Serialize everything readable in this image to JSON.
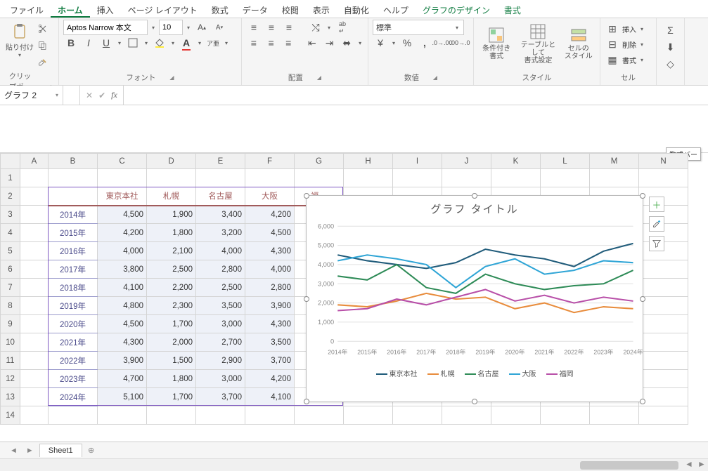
{
  "tabs": {
    "file": "ファイル",
    "home": "ホーム",
    "insert": "挿入",
    "pagelayout": "ページ レイアウト",
    "formulas": "数式",
    "data": "データ",
    "review": "校閲",
    "view": "表示",
    "automate": "自動化",
    "help": "ヘルプ",
    "chartdesign": "グラフのデザイン",
    "format": "書式"
  },
  "ribbon": {
    "clipboard": "クリップボード",
    "font": "フォント",
    "alignment": "配置",
    "number": "数値",
    "styles": "スタイル",
    "cells": "セル",
    "paste": "貼り付け",
    "font_name": "Aptos Narrow 本文",
    "font_size": "10",
    "number_format": "標準",
    "condfmt": "条件付き\n書式",
    "tablefmt": "テーブルとして\n書式設定",
    "cellstyles": "セルの\nスタイル",
    "insert_btn": "挿入",
    "delete_btn": "削除",
    "format_btn": "書式"
  },
  "namebox": "グラフ 2",
  "fx_tooltip": "数式バー",
  "cols": [
    "A",
    "B",
    "C",
    "D",
    "E",
    "F",
    "G",
    "H",
    "I",
    "J",
    "K",
    "L",
    "M",
    "N"
  ],
  "rows": [
    "1",
    "2",
    "3",
    "4",
    "5",
    "6",
    "7",
    "8",
    "9",
    "10",
    "11",
    "12",
    "13",
    "14"
  ],
  "table": {
    "loc_headers": [
      "",
      "東京本社",
      "札幌",
      "名古屋",
      "大阪",
      "福岡"
    ],
    "years": [
      "2014年",
      "2015年",
      "2016年",
      "2017年",
      "2018年",
      "2019年",
      "2020年",
      "2021年",
      "2022年",
      "2023年",
      "2024年"
    ],
    "data": [
      [
        "4,500",
        "1,900",
        "3,400",
        "4,200"
      ],
      [
        "4,200",
        "1,800",
        "3,200",
        "4,500"
      ],
      [
        "4,000",
        "2,100",
        "4,000",
        "4,300"
      ],
      [
        "3,800",
        "2,500",
        "2,800",
        "4,000"
      ],
      [
        "4,100",
        "2,200",
        "2,500",
        "2,800"
      ],
      [
        "4,800",
        "2,300",
        "3,500",
        "3,900"
      ],
      [
        "4,500",
        "1,700",
        "3,000",
        "4,300"
      ],
      [
        "4,300",
        "2,000",
        "2,700",
        "3,500"
      ],
      [
        "3,900",
        "1,500",
        "2,900",
        "3,700"
      ],
      [
        "4,700",
        "1,800",
        "3,000",
        "4,200"
      ],
      [
        "5,100",
        "1,700",
        "3,700",
        "4,100"
      ]
    ],
    "cut_value": "2,100"
  },
  "chart_data": {
    "type": "line",
    "title": "グラフ タイトル",
    "categories": [
      "2014年",
      "2015年",
      "2016年",
      "2017年",
      "2018年",
      "2019年",
      "2020年",
      "2021年",
      "2022年",
      "2023年",
      "2024年"
    ],
    "series": [
      {
        "name": "東京本社",
        "color": "#1f5b7a",
        "values": [
          4500,
          4200,
          4000,
          3800,
          4100,
          4800,
          4500,
          4300,
          3900,
          4700,
          5100
        ]
      },
      {
        "name": "札幌",
        "color": "#e88c3c",
        "values": [
          1900,
          1800,
          2100,
          2500,
          2200,
          2300,
          1700,
          2000,
          1500,
          1800,
          1700
        ]
      },
      {
        "name": "名古屋",
        "color": "#2e8b57",
        "values": [
          3400,
          3200,
          4000,
          2800,
          2500,
          3500,
          3000,
          2700,
          2900,
          3000,
          3700
        ]
      },
      {
        "name": "大阪",
        "color": "#2fa5d6",
        "values": [
          4200,
          4500,
          4300,
          4000,
          2800,
          3900,
          4300,
          3500,
          3700,
          4200,
          4100
        ]
      },
      {
        "name": "福岡",
        "color": "#b84fa8",
        "values": [
          1600,
          1700,
          2200,
          1900,
          2300,
          2700,
          2100,
          2400,
          2000,
          2300,
          2100
        ]
      }
    ],
    "ylim": [
      0,
      6000
    ],
    "yticks": [
      0,
      1000,
      2000,
      3000,
      4000,
      5000,
      6000
    ],
    "xlabel": "",
    "ylabel": ""
  },
  "sheet": {
    "name": "Sheet1"
  }
}
